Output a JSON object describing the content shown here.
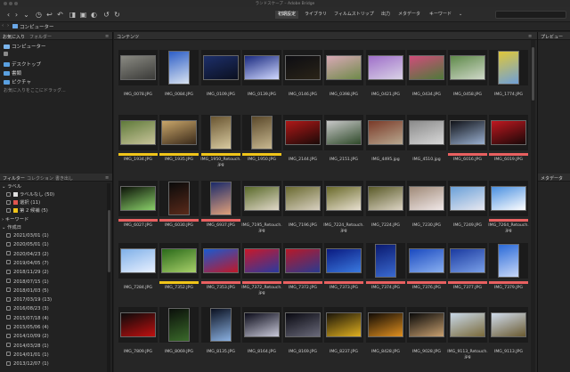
{
  "window": {
    "title": "ランドスケープ – Adobe Bridge"
  },
  "toolbar": {
    "workspaces": [
      "初期設定",
      "ライブラリ",
      "フィルムストリップ",
      "出力",
      "メタデータ",
      "キーワード"
    ],
    "active_workspace": 0,
    "workspace_more": "⌄"
  },
  "path": {
    "current": "コンピューター"
  },
  "panels": {
    "favorites_tab": "お気に入り",
    "folders_tab": "フォルダー",
    "content_tab": "コンテンツ",
    "preview_tab": "プレビュー",
    "metadata_tab": "メタデータ",
    "filter_tab": "フィルター",
    "collection_tab": "コレクション",
    "export_tab": "書き出し"
  },
  "favorites": [
    {
      "label": "コンピューター",
      "icon": "computer-icon"
    },
    {
      "label": "",
      "icon": "home-icon"
    },
    {
      "label": "デスクトップ",
      "icon": "folder-icon"
    },
    {
      "label": "書類",
      "icon": "folder-icon"
    },
    {
      "label": "ピクチャ",
      "icon": "folder-icon"
    }
  ],
  "favorites_hint": "お気に入りをここにドラッグ...",
  "filters": {
    "label_header": "ラベル",
    "labels": [
      {
        "label": "ラベルなし (50)",
        "color": "#e0e0e0"
      },
      {
        "label": "選択 (11)",
        "color": "#e0554f"
      },
      {
        "label": "第 2 候補 (5)",
        "color": "#f0c419"
      }
    ],
    "keyword_header": "キーワード",
    "date_header": "作成日",
    "dates": [
      "2021/03/01 (1)",
      "2020/05/01 (1)",
      "2020/04/23 (2)",
      "2019/04/05 (7)",
      "2018/11/29 (2)",
      "2018/07/15 (1)",
      "2018/01/03 (5)",
      "2017/03/19 (13)",
      "2016/08/23 (3)",
      "2015/07/18 (4)",
      "2015/05/06 (4)",
      "2014/10/09 (2)",
      "2014/03/28 (1)",
      "2014/01/01 (1)",
      "2013/12/07 (1)"
    ]
  },
  "colors": {
    "red_label": "#e86060",
    "yellow_label": "#f0c419"
  },
  "thumbnails": [
    {
      "name": "IMG_0078.JPG",
      "label": "",
      "orient": "land",
      "c1": "#8a8a82",
      "c2": "#3a3a38"
    },
    {
      "name": "IMG_0084.JPG",
      "label": "",
      "orient": "port",
      "c1": "#2e5fc7",
      "c2": "#d8e2f0"
    },
    {
      "name": "IMG_0109.JPG",
      "label": "",
      "orient": "land",
      "c1": "#1d2f6a",
      "c2": "#0b1020"
    },
    {
      "name": "IMG_0139.JPG",
      "label": "",
      "orient": "land",
      "c1": "#1a2a80",
      "c2": "#d0d8ff"
    },
    {
      "name": "IMG_0146.JPG",
      "label": "",
      "orient": "land",
      "c1": "#0d0d12",
      "c2": "#2a2418"
    },
    {
      "name": "IMG_0398.JPG",
      "label": "",
      "orient": "land",
      "c1": "#d9a9b6",
      "c2": "#6f8a4a"
    },
    {
      "name": "IMG_0421.JPG",
      "label": "",
      "orient": "land",
      "c1": "#9f6fc9",
      "c2": "#d9d2e6"
    },
    {
      "name": "IMG_0434.JPG",
      "label": "",
      "orient": "land",
      "c1": "#d04c7a",
      "c2": "#4e7a3a"
    },
    {
      "name": "IMG_0458.JPG",
      "label": "",
      "orient": "land",
      "c1": "#5f8a4a",
      "c2": "#cfd8c8"
    },
    {
      "name": "IMG_1774.JPG",
      "label": "",
      "orient": "port",
      "c1": "#e0c73a",
      "c2": "#6fa0d8"
    },
    {
      "name": "IMG_1934.JPG",
      "label": "yellow",
      "orient": "land",
      "c1": "#5f7a3a",
      "c2": "#c8c49a"
    },
    {
      "name": "IMG_1935.JPG",
      "label": "yellow",
      "orient": "land",
      "c1": "#c9a66a",
      "c2": "#3a2a1a"
    },
    {
      "name": "IMG_1950_Retouch.jpg",
      "label": "yellow",
      "orient": "port",
      "c1": "#6a5632",
      "c2": "#d8caa0"
    },
    {
      "name": "IMG_1950.JPG",
      "label": "yellow",
      "orient": "port",
      "c1": "#5a482a",
      "c2": "#c8b890"
    },
    {
      "name": "IMG_2144.JPG",
      "label": "",
      "orient": "land",
      "c1": "#b01818",
      "c2": "#1a0a08"
    },
    {
      "name": "IMG_2151.JPG",
      "label": "",
      "orient": "land",
      "c1": "#c8c8c8",
      "c2": "#2f4a2a"
    },
    {
      "name": "IMG_4495.jpg",
      "label": "",
      "orient": "land",
      "c1": "#7a3a28",
      "c2": "#b8a890"
    },
    {
      "name": "IMG_4510.jpg",
      "label": "",
      "orient": "land",
      "c1": "#8a8a8a",
      "c2": "#d8d8d8"
    },
    {
      "name": "IMG_6016.JPG",
      "label": "red",
      "orient": "land",
      "c1": "#101218",
      "c2": "#9ab0d0"
    },
    {
      "name": "IMG_6019.JPG",
      "label": "red",
      "orient": "land",
      "c1": "#c01820",
      "c2": "#180808"
    },
    {
      "name": "IMG_6027.JPG",
      "label": "red",
      "orient": "land",
      "c1": "#0c1208",
      "c2": "#8ad06a"
    },
    {
      "name": "IMG_6030.JPG",
      "label": "red",
      "orient": "port",
      "c1": "#0a0a0a",
      "c2": "#5a2a1a"
    },
    {
      "name": "IMG_6937.JPG",
      "label": "red",
      "orient": "port",
      "c1": "#1a2a6a",
      "c2": "#e0a07a"
    },
    {
      "name": "IMG_7195_Retouch.jpg",
      "label": "",
      "orient": "land",
      "c1": "#5a6a2a",
      "c2": "#e0d8c8"
    },
    {
      "name": "IMG_7196.JPG",
      "label": "",
      "orient": "land",
      "c1": "#6a6a30",
      "c2": "#d8d0c0"
    },
    {
      "name": "IMG_7224_Retouch.jpg",
      "label": "",
      "orient": "land",
      "c1": "#6a6a2a",
      "c2": "#e8e0d0"
    },
    {
      "name": "IMG_7224.JPG",
      "label": "",
      "orient": "land",
      "c1": "#5a5a28",
      "c2": "#dcd4c4"
    },
    {
      "name": "IMG_7230.JPG",
      "label": "",
      "orient": "land",
      "c1": "#a08a78",
      "c2": "#f0e8e8"
    },
    {
      "name": "IMG_7249.JPG",
      "label": "",
      "orient": "land",
      "c1": "#6aa0d8",
      "c2": "#e8e8f0"
    },
    {
      "name": "IMG_7264_Retouch.jpg",
      "label": "red",
      "orient": "land",
      "c1": "#4a90e0",
      "c2": "#ffffff"
    },
    {
      "name": "IMG_7284.JPG",
      "label": "",
      "orient": "land",
      "c1": "#7fb0e8",
      "c2": "#e8f0ff"
    },
    {
      "name": "IMG_7352.JPG",
      "label": "yellow",
      "orient": "land",
      "c1": "#2a6a1a",
      "c2": "#a8d06a"
    },
    {
      "name": "IMG_7353.JPG",
      "label": "red",
      "orient": "land",
      "c1": "#1a5ad0",
      "c2": "#c01828"
    },
    {
      "name": "IMG_7372_Retouch.jpg",
      "label": "red",
      "orient": "land",
      "c1": "#c8182a",
      "c2": "#2a3aa0"
    },
    {
      "name": "IMG_7372.JPG",
      "label": "red",
      "orient": "land",
      "c1": "#b81828",
      "c2": "#2a3a90"
    },
    {
      "name": "IMG_7373.JPG",
      "label": "red",
      "orient": "land",
      "c1": "#0a1a80",
      "c2": "#3a7ae0"
    },
    {
      "name": "IMG_7374.JPG",
      "label": "red",
      "orient": "port",
      "c1": "#0a1a70",
      "c2": "#3a6ad0"
    },
    {
      "name": "IMG_7376.JPG",
      "label": "red",
      "orient": "land",
      "c1": "#1a4ac0",
      "c2": "#8ab0f0"
    },
    {
      "name": "IMG_7377.JPG",
      "label": "red",
      "orient": "land",
      "c1": "#1a3aa0",
      "c2": "#7aa0e8"
    },
    {
      "name": "IMG_7379.JPG",
      "label": "red",
      "orient": "port",
      "c1": "#2a6ad8",
      "c2": "#c8d8f8"
    },
    {
      "name": "IMG_7809.JPG",
      "label": "",
      "orient": "land",
      "c1": "#0a0a0a",
      "c2": "#c01010"
    },
    {
      "name": "IMG_8069.JPG",
      "label": "",
      "orient": "port",
      "c1": "#0a0f0a",
      "c2": "#3a6a2a"
    },
    {
      "name": "IMG_8135.JPG",
      "label": "",
      "orient": "port",
      "c1": "#0a1020",
      "c2": "#8ab0e0"
    },
    {
      "name": "IMG_8164.JPG",
      "label": "",
      "orient": "land",
      "c1": "#0a0a18",
      "c2": "#c8c8d8"
    },
    {
      "name": "IMG_8169.JPG",
      "label": "",
      "orient": "land",
      "c1": "#080810",
      "c2": "#6a6a7a"
    },
    {
      "name": "IMG_8237.JPG",
      "label": "",
      "orient": "land",
      "c1": "#1a1408",
      "c2": "#e0b020"
    },
    {
      "name": "IMG_8428.JPG",
      "label": "",
      "orient": "land",
      "c1": "#100a04",
      "c2": "#e09020"
    },
    {
      "name": "IMG_9028.JPG",
      "label": "",
      "orient": "land",
      "c1": "#080808",
      "c2": "#c8a070"
    },
    {
      "name": "IMG_9113_Retouch.jpg",
      "label": "",
      "orient": "land",
      "c1": "#c8d8e8",
      "c2": "#7a6a3a"
    },
    {
      "name": "IMG_9113.JPG",
      "label": "",
      "orient": "land",
      "c1": "#d0dcec",
      "c2": "#6a5a30"
    }
  ]
}
